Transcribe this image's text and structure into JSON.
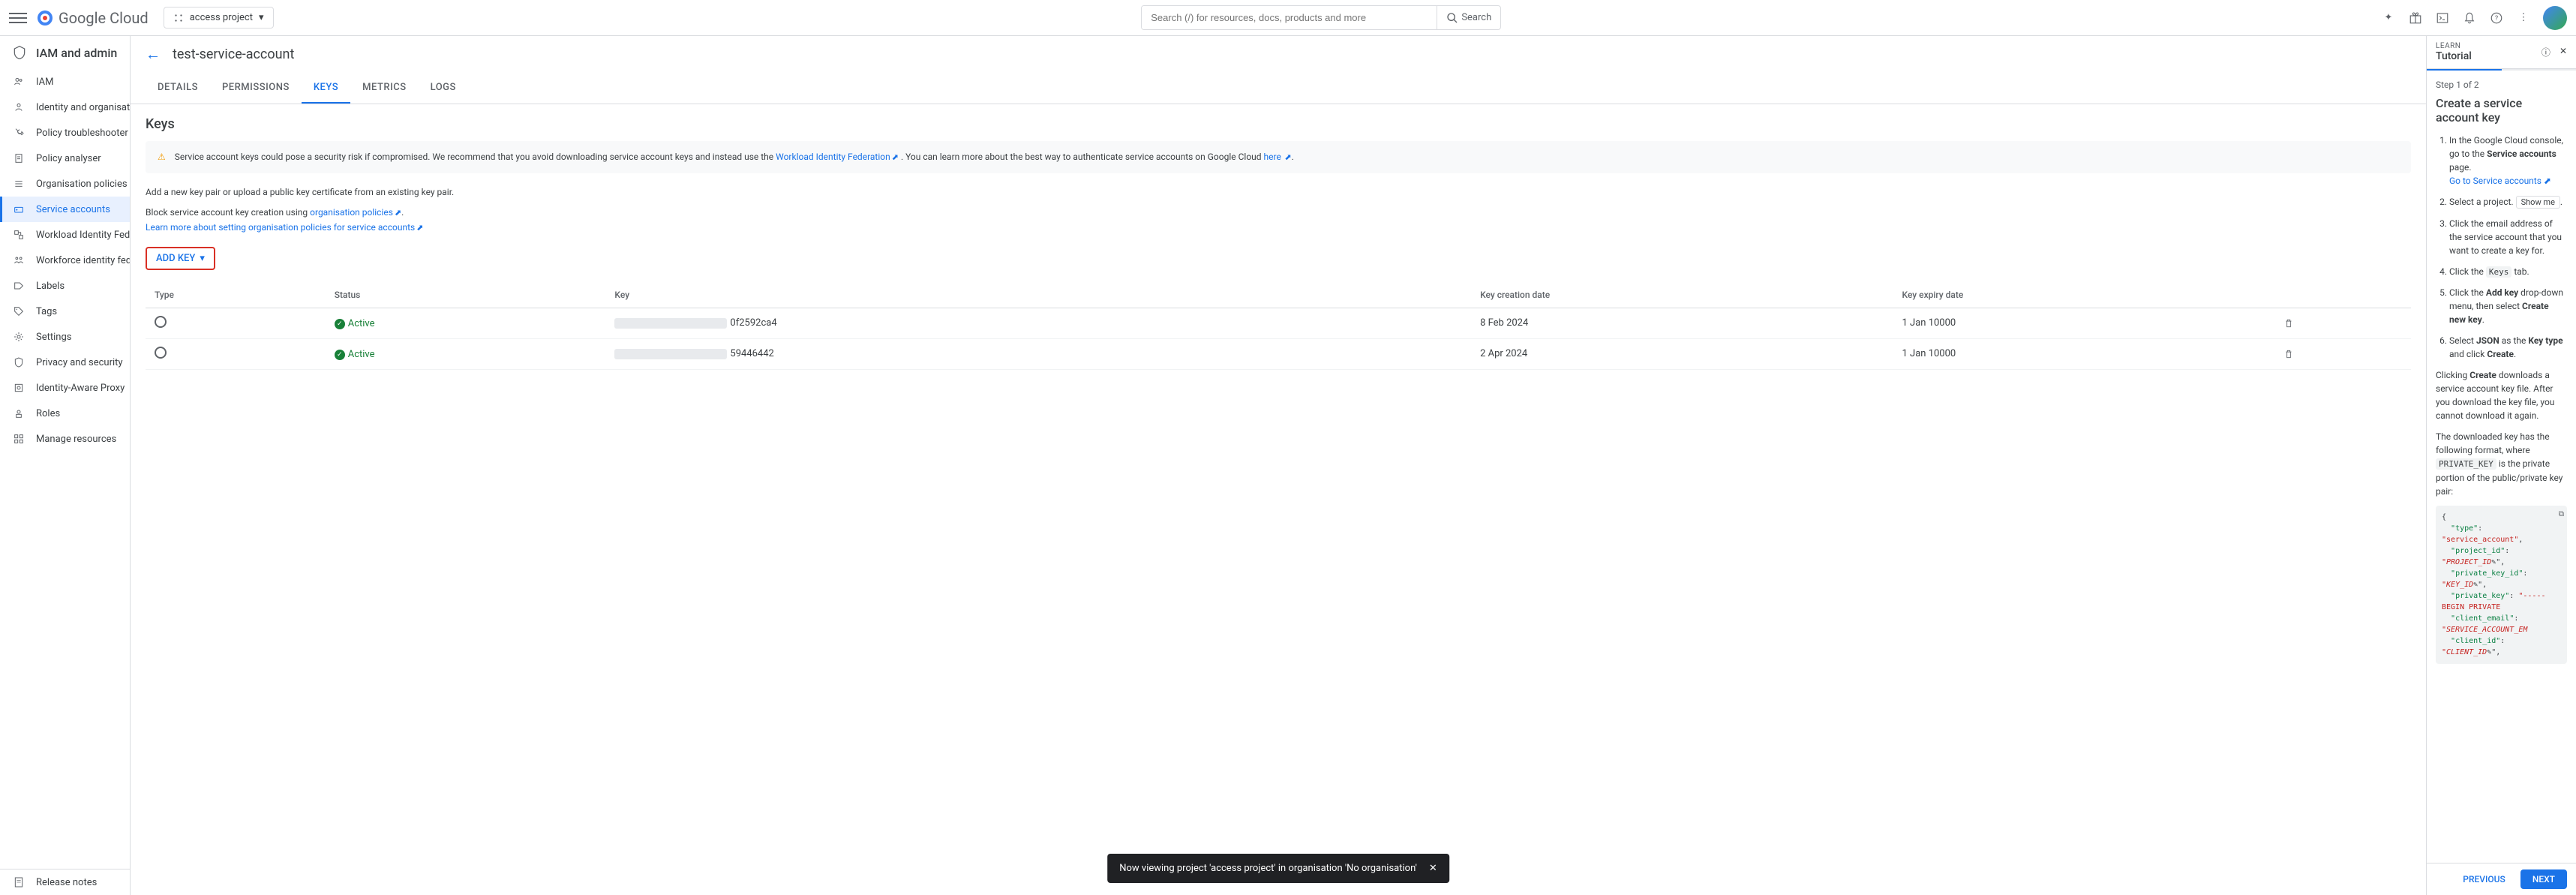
{
  "header": {
    "logo_text": "Google Cloud",
    "project_picker": "access project",
    "search_placeholder": "Search (/) for resources, docs, products and more",
    "search_button": "Search"
  },
  "sidebar": {
    "title": "IAM and admin",
    "items": [
      {
        "label": "IAM",
        "icon": "people"
      },
      {
        "label": "Identity and organisation",
        "icon": "identity"
      },
      {
        "label": "Policy troubleshooter",
        "icon": "wrench"
      },
      {
        "label": "Policy analyser",
        "icon": "doc"
      },
      {
        "label": "Organisation policies",
        "icon": "list"
      },
      {
        "label": "Service accounts",
        "icon": "service",
        "active": true
      },
      {
        "label": "Workload Identity Federa...",
        "icon": "workload"
      },
      {
        "label": "Workforce identity federat...",
        "icon": "workforce"
      },
      {
        "label": "Labels",
        "icon": "label"
      },
      {
        "label": "Tags",
        "icon": "tags"
      },
      {
        "label": "Settings",
        "icon": "gear"
      },
      {
        "label": "Privacy and security",
        "icon": "shield"
      },
      {
        "label": "Identity-Aware Proxy",
        "icon": "iap"
      },
      {
        "label": "Roles",
        "icon": "roles"
      },
      {
        "label": "Manage resources",
        "icon": "manage"
      }
    ],
    "footer_item": {
      "label": "Release notes",
      "icon": "notes"
    }
  },
  "main": {
    "page_title": "test-service-account",
    "tabs": [
      "DETAILS",
      "PERMISSIONS",
      "KEYS",
      "METRICS",
      "LOGS"
    ],
    "active_tab": "KEYS",
    "section_title": "Keys",
    "warning": {
      "pre": "Service account keys could pose a security risk if compromised. We recommend that you avoid downloading service account keys and instead use the ",
      "link1": "Workload Identity Federation",
      "mid": ". You can learn more about the best way to authenticate service accounts on Google Cloud ",
      "link2": "here",
      "post": "."
    },
    "helper1": "Add a new key pair or upload a public key certificate from an existing key pair.",
    "helper2_pre": "Block service account key creation using ",
    "helper2_link": "organisation policies",
    "helper2_post": ".",
    "helper3": "Learn more about setting organisation policies for service accounts",
    "add_key_button": "ADD KEY",
    "table": {
      "headers": [
        "Type",
        "Status",
        "Key",
        "Key creation date",
        "Key expiry date",
        ""
      ],
      "rows": [
        {
          "status": "Active",
          "key_suffix": "0f2592ca4",
          "created": "8 Feb 2024",
          "expires": "1 Jan 10000"
        },
        {
          "status": "Active",
          "key_suffix": "59446442",
          "created": "2 Apr 2024",
          "expires": "1 Jan 10000"
        }
      ]
    },
    "toast": "Now viewing project 'access project' in organisation 'No organisation'"
  },
  "tutorial": {
    "label": "LEARN",
    "title": "Tutorial",
    "step_counter": "Step 1 of 2",
    "heading": "Create a service account key",
    "step1_pre": "In the Google Cloud console, go to the ",
    "step1_bold": "Service accounts",
    "step1_post": " page.",
    "step1_link": "Go to Service accounts",
    "step2_pre": "Select a project. ",
    "step2_btn": "Show me",
    "step3": "Click the email address of the service account that you want to create a key for.",
    "step4_pre": "Click the ",
    "step4_chip": "Keys",
    "step4_post": " tab.",
    "step5_pre": "Click the ",
    "step5_bold": "Add key",
    "step5_mid": " drop-down menu, then select ",
    "step5_bold2": "Create new key",
    "step5_post": ".",
    "step6_pre": "Select ",
    "step6_bold1": "JSON",
    "step6_mid": " as the ",
    "step6_bold2": "Key type",
    "step6_mid2": " and click ",
    "step6_bold3": "Create",
    "step6_post": ".",
    "para1_pre": "Clicking ",
    "para1_bold": "Create",
    "para1_post": " downloads a service account key file. After you download the key file, you cannot download it again.",
    "para2_pre": "The downloaded key has the following format, where ",
    "para2_chip": "PRIVATE_KEY",
    "para2_post": " is the private portion of the public/private key pair:",
    "code": {
      "l1k": "\"type\"",
      "l1v": "\"service_account\"",
      "l2k": "\"project_id\"",
      "l2v": "\"PROJECT_ID",
      "l3k": "\"private_key_id\"",
      "l3v": "\"KEY_ID",
      "l4k": "\"private_key\"",
      "l4v": "\"-----BEGIN PRIVATE",
      "l5k": "\"client_email\"",
      "l5v": "\"SERVICE_ACCOUNT_EM",
      "l6k": "\"client_id\"",
      "l6v": "\"CLIENT_ID"
    },
    "prev_btn": "PREVIOUS",
    "next_btn": "NEXT"
  }
}
